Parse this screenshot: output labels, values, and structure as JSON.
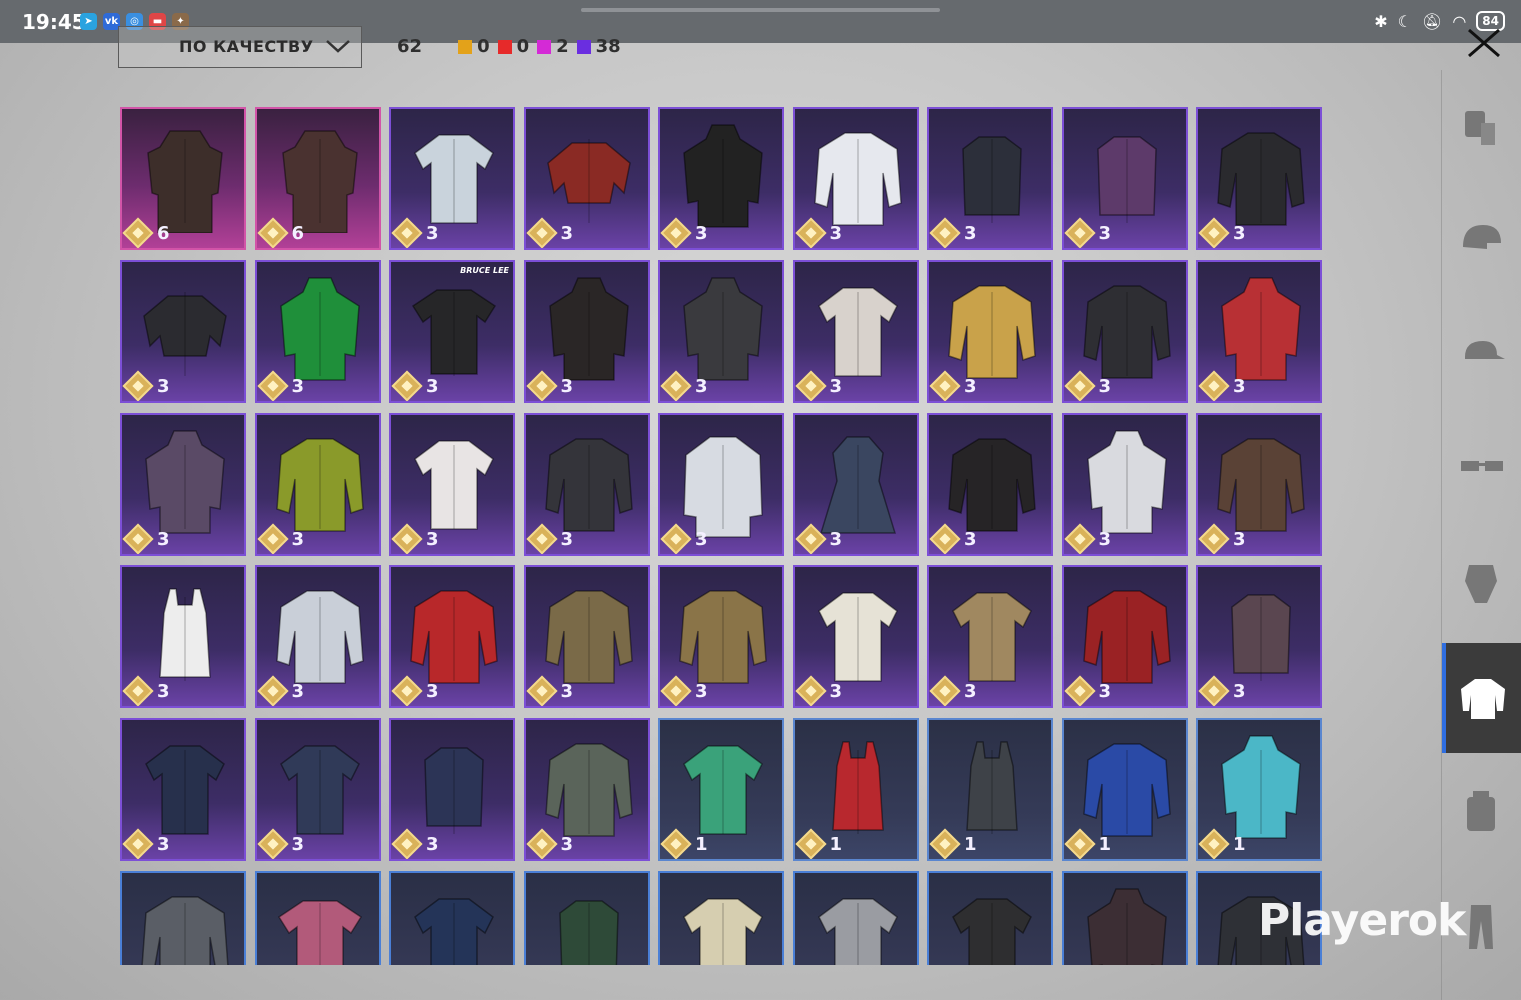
{
  "status_bar": {
    "time": "19:45",
    "battery": "84",
    "notification_icons": [
      "telegram-icon",
      "vk-icon",
      "app-icon",
      "app-icon",
      "app-icon"
    ],
    "system_icons": [
      "bluetooth-icon",
      "moon-icon",
      "mute-icon",
      "wifi-icon",
      "battery-icon"
    ]
  },
  "toolbar": {
    "sort_label": "ПО КАЧЕСТВУ",
    "total_count": "62",
    "rarity_counts": [
      {
        "color": "#e3a21a",
        "count": "0"
      },
      {
        "color": "#e62a2a",
        "count": "0"
      },
      {
        "color": "#d42ad6",
        "count": "2"
      },
      {
        "color": "#6a2ee0",
        "count": "38"
      }
    ]
  },
  "grid": {
    "rows": [
      [
        {
          "rarity": "legendary",
          "value": "6",
          "color": "#3d2e2a",
          "icon": "trench-coat-icon"
        },
        {
          "rarity": "legendary",
          "value": "6",
          "color": "#4a3230",
          "icon": "trench-coat-icon"
        },
        {
          "rarity": "epic",
          "value": "3",
          "color": "#c9d3dc",
          "icon": "shirt-icon"
        },
        {
          "rarity": "epic",
          "value": "3",
          "color": "#8a2a24",
          "icon": "top-icon"
        },
        {
          "rarity": "epic",
          "value": "3",
          "color": "#222222",
          "icon": "hoodie-icon"
        },
        {
          "rarity": "epic",
          "value": "3",
          "color": "#e6e8ee",
          "icon": "jacket-icon"
        },
        {
          "rarity": "epic",
          "value": "3",
          "color": "#2c2f3a",
          "icon": "vest-icon"
        },
        {
          "rarity": "epic",
          "value": "3",
          "color": "#5d3a6a",
          "icon": "vest-icon"
        },
        {
          "rarity": "epic",
          "value": "3",
          "color": "#2a2a2e",
          "icon": "jacket-icon"
        }
      ],
      [
        {
          "rarity": "epic",
          "value": "3",
          "color": "#2b2b30",
          "icon": "top-icon"
        },
        {
          "rarity": "epic",
          "value": "3",
          "color": "#1f8f3a",
          "icon": "hoodie-icon"
        },
        {
          "rarity": "epic",
          "value": "3",
          "color": "#262628",
          "icon": "tshirt-icon",
          "brand": "BRUCE LEE"
        },
        {
          "rarity": "epic",
          "value": "3",
          "color": "#2a2626",
          "icon": "hoodie-icon"
        },
        {
          "rarity": "epic",
          "value": "3",
          "color": "#3a3a3e",
          "icon": "hoodie-icon"
        },
        {
          "rarity": "epic",
          "value": "3",
          "color": "#d8d2cc",
          "icon": "shirt-icon"
        },
        {
          "rarity": "epic",
          "value": "3",
          "color": "#c9a24a",
          "icon": "jacket-icon"
        },
        {
          "rarity": "epic",
          "value": "3",
          "color": "#2e2e33",
          "icon": "jacket-icon"
        },
        {
          "rarity": "epic",
          "value": "3",
          "color": "#b83034",
          "icon": "hoodie-icon"
        }
      ],
      [
        {
          "rarity": "epic",
          "value": "3",
          "color": "#5a4a66",
          "icon": "hoodie-icon"
        },
        {
          "rarity": "epic",
          "value": "3",
          "color": "#8a9a2a",
          "icon": "jacket-icon"
        },
        {
          "rarity": "epic",
          "value": "3",
          "color": "#e8e4e4",
          "icon": "shirt-icon"
        },
        {
          "rarity": "epic",
          "value": "3",
          "color": "#34343a",
          "icon": "jacket-icon"
        },
        {
          "rarity": "epic",
          "value": "3",
          "color": "#d7dbe2",
          "icon": "coat-icon"
        },
        {
          "rarity": "epic",
          "value": "3",
          "color": "#3a4660",
          "icon": "dress-icon"
        },
        {
          "rarity": "epic",
          "value": "3",
          "color": "#262426",
          "icon": "jacket-icon"
        },
        {
          "rarity": "epic",
          "value": "3",
          "color": "#d9dadf",
          "icon": "hoodie-icon"
        },
        {
          "rarity": "epic",
          "value": "3",
          "color": "#5a4236",
          "icon": "jacket-icon"
        }
      ],
      [
        {
          "rarity": "epic",
          "value": "3",
          "color": "#ededed",
          "icon": "tank-top-icon"
        },
        {
          "rarity": "epic",
          "value": "3",
          "color": "#c9cfd8",
          "icon": "jacket-icon"
        },
        {
          "rarity": "epic",
          "value": "3",
          "color": "#b8282a",
          "icon": "jacket-icon"
        },
        {
          "rarity": "epic",
          "value": "3",
          "color": "#7a6a48",
          "icon": "jacket-icon"
        },
        {
          "rarity": "epic",
          "value": "3",
          "color": "#8a7448",
          "icon": "jacket-icon"
        },
        {
          "rarity": "epic",
          "value": "3",
          "color": "#e6e2d6",
          "icon": "shirt-icon"
        },
        {
          "rarity": "epic",
          "value": "3",
          "color": "#a08860",
          "icon": "shirt-icon"
        },
        {
          "rarity": "epic",
          "value": "3",
          "color": "#9a2224",
          "icon": "jacket-icon"
        },
        {
          "rarity": "epic",
          "value": "3",
          "color": "#5a4650",
          "icon": "vest-icon"
        }
      ],
      [
        {
          "rarity": "epic",
          "value": "3",
          "color": "#27304c",
          "icon": "shirt-icon"
        },
        {
          "rarity": "epic",
          "value": "3",
          "color": "#303a58",
          "icon": "shirt-icon"
        },
        {
          "rarity": "epic",
          "value": "3",
          "color": "#2c3456",
          "icon": "vest-icon"
        },
        {
          "rarity": "epic",
          "value": "3",
          "color": "#5a645a",
          "icon": "jacket-icon"
        },
        {
          "rarity": "rare",
          "value": "1",
          "color": "#3aa27a",
          "icon": "shirt-icon"
        },
        {
          "rarity": "rare",
          "value": "1",
          "color": "#b8282e",
          "icon": "tank-top-icon"
        },
        {
          "rarity": "rare",
          "value": "1",
          "color": "#3e4248",
          "icon": "tank-top-icon"
        },
        {
          "rarity": "rare",
          "value": "1",
          "color": "#2a4aa6",
          "icon": "jacket-icon"
        },
        {
          "rarity": "rare",
          "value": "1",
          "color": "#4bb7c7",
          "icon": "hoodie-icon"
        }
      ],
      [
        {
          "rarity": "plain",
          "color": "#5a5e66",
          "icon": "jacket-icon"
        },
        {
          "rarity": "plain",
          "color": "#b25a7a",
          "icon": "tshirt-icon"
        },
        {
          "rarity": "plain",
          "color": "#243458",
          "icon": "shirt-icon"
        },
        {
          "rarity": "plain",
          "color": "#2e4a38",
          "icon": "vest-icon"
        },
        {
          "rarity": "plain",
          "color": "#d6ceb0",
          "icon": "shirt-icon"
        },
        {
          "rarity": "plain",
          "color": "#9a9ca2",
          "icon": "shirt-icon"
        },
        {
          "rarity": "plain",
          "color": "#2e2e30",
          "icon": "shirt-icon"
        },
        {
          "rarity": "plain",
          "color": "#3c2e34",
          "icon": "hoodie-icon"
        },
        {
          "rarity": "plain",
          "color": "#2e3036",
          "icon": "jacket-icon"
        }
      ]
    ]
  },
  "right_rail": {
    "categories": [
      {
        "icon": "outfit-icon",
        "active": false
      },
      {
        "icon": "helmet-icon",
        "active": false
      },
      {
        "icon": "cap-icon",
        "active": false
      },
      {
        "icon": "glasses-icon",
        "active": false
      },
      {
        "icon": "mask-icon",
        "active": false
      },
      {
        "icon": "jacket-icon",
        "active": true
      },
      {
        "icon": "backpack-icon",
        "active": false
      },
      {
        "icon": "pants-icon",
        "active": false
      }
    ]
  },
  "watermark": "Playerok"
}
